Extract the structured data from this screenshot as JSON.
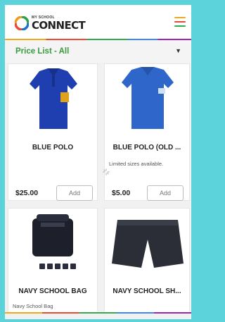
{
  "header": {
    "logo_small": "MY SCHOOL",
    "logo_big": "CONNECT",
    "menu_icon": "hamburger-menu-icon",
    "colors": {
      "logo_green": "#2e9e48",
      "logo_blue": "#1a73c8",
      "logo_orange": "#f29a1b",
      "logo_red": "#e94b35"
    }
  },
  "price_list": {
    "title": "Price List - All",
    "dropdown_icon": "caret-down-icon",
    "title_color": "#3a9a3e"
  },
  "products": [
    {
      "name": "BLUE POLO",
      "description": "",
      "price": "$25.00",
      "button": "Add",
      "image": "blue-polo-shirt"
    },
    {
      "name": "BLUE POLO (OLD ...",
      "description": "Limited sizes available.",
      "price": "$5.00",
      "button": "Add",
      "image": "blue-polo-shirt-old"
    },
    {
      "name": "NAVY SCHOOL BAG",
      "description": "Navy School Bag",
      "price": "",
      "button": "",
      "image": "navy-school-bag"
    },
    {
      "name": "NAVY SCHOOL SH...",
      "description": "",
      "price": "",
      "button": "",
      "image": "navy-school-shorts"
    }
  ]
}
